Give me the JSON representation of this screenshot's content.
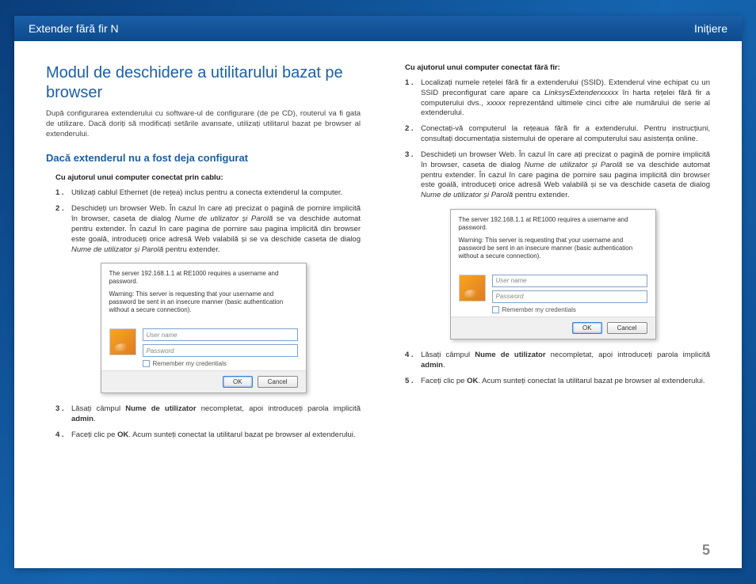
{
  "header": {
    "left": "Extender fără fir N",
    "right": "Inițiere"
  },
  "title": "Modul de deschidere a utilitarului bazat pe browser",
  "intro": "După configurarea extenderului cu software-ul de configurare (de pe CD), routerul va fi gata de utilizare. Dacă doriți să modificați setările avansate, utilizați utilitarul bazat pe browser al extenderului.",
  "subtitle": "Dacă extenderul nu a fost deja configurat",
  "cable_heading": "Cu ajutorul unui computer conectat prin cablu:",
  "wireless_heading": "Cu ajutorul unui computer conectat fără fir:",
  "cable_steps": [
    {
      "n": "1 .",
      "t": "Utilizați cablul Ethernet (de rețea) inclus pentru a conecta extenderul la computer."
    },
    {
      "n": "2 .",
      "t": "Deschideți un browser Web. În cazul în care ați precizat o pagină de pornire implicită în browser, caseta de dialog <span class='it'>Nume de utilizator și Parolă</span> se va deschide automat pentru extender. În cazul în care pagina de pornire sau pagina implicită din browser este goală, introduceți orice adresă Web valabilă și se va deschide caseta de dialog <span class='it'>Nume de utilizator și Parolă</span> pentru extender."
    }
  ],
  "cable_steps_after": [
    {
      "n": "3 .",
      "t": "Lăsați câmpul <span class='b'>Nume de utilizator</span> necompletat, apoi introduceți parola implicită <span class='b'>admin</span>."
    },
    {
      "n": "4 .",
      "t": "Faceți clic pe <span class='b'>OK</span>. Acum sunteți conectat la utilitarul bazat pe browser al extenderului."
    }
  ],
  "wireless_steps": [
    {
      "n": "1 .",
      "t": "Localizați numele rețelei fără fir a extenderului (SSID). Extenderul vine echipat cu un SSID preconfigurat care apare ca <span class='it'>LinksysExtenderxxxxx</span> în harta rețelei fără fir a computerului dvs., <span class='it'>xxxxx</span> reprezentând ultimele cinci cifre ale numărului de serie al extenderului."
    },
    {
      "n": "2 .",
      "t": "Conectați-vă computerul la rețeaua fără fir a extenderului. Pentru instrucțiuni, consultați documentația sistemului de operare al computerului sau asistența online."
    },
    {
      "n": "3 .",
      "t": "Deschideți un browser Web. În cazul în care ați precizat o pagină de pornire implicită în browser, caseta de dialog <span class='it'>Nume de utilizator și Parolă</span> se va deschide automat pentru extender. În cazul în care pagina de pornire sau pagina implicită din browser este goală, introduceți orice adresă Web valabilă și se va deschide caseta de dialog <span class='it'>Nume de utilizator și Parolă</span> pentru extender."
    }
  ],
  "wireless_steps_after": [
    {
      "n": "4 .",
      "t": "Lăsați câmpul <span class='b'>Nume de utilizator</span> necompletat, apoi introduceți parola implicită <span class='b'>admin</span>."
    },
    {
      "n": "5 .",
      "t": "Faceți clic pe <span class='b'>OK</span>. Acum sunteți conectat la utilitarul bazat pe browser al extenderului."
    }
  ],
  "dialog": {
    "line1": "The server 192.168.1.1 at RE1000 requires a username and password.",
    "line2": "Warning: This server is requesting that your username and password be sent in an insecure manner (basic authentication without a secure connection).",
    "user_ph": "User name",
    "pass_ph": "Password",
    "remember": "Remember my credentials",
    "ok": "OK",
    "cancel": "Cancel"
  },
  "page_number": "5"
}
